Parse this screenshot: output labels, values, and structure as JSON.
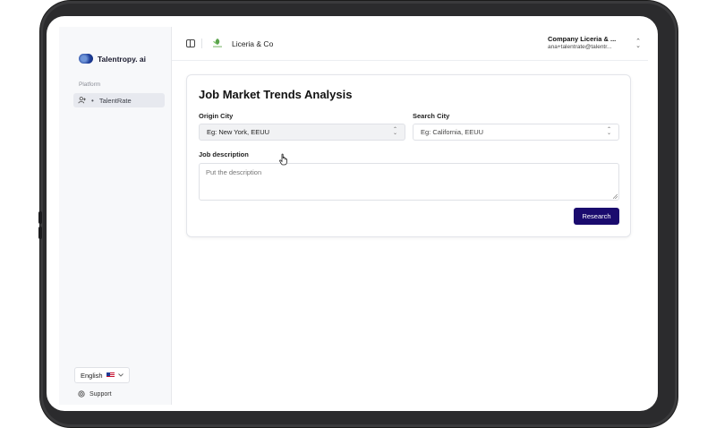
{
  "sidebar": {
    "brand": "Talentropy. ai",
    "group_label": "Platform",
    "items": [
      {
        "label": "TalentRate",
        "icon": "user-plus-icon"
      }
    ],
    "language": "English",
    "support": "Support"
  },
  "topbar": {
    "organization": "Liceria & Co",
    "company": "Company Liceria & ...",
    "email": "ana+talentrate@talentr..."
  },
  "form": {
    "title": "Job Market Trends Analysis",
    "origin_label": "Origin City",
    "origin_placeholder": "Eg: New York, EEUU",
    "search_label": "Search City",
    "search_placeholder": "Eg: California, EEUU",
    "description_label": "Job description",
    "description_placeholder": "Put the description",
    "submit_label": "Research"
  },
  "colors": {
    "primary": "#1a0b6e",
    "sidebar_bg": "#f7f8fa",
    "brand_blue": "#1f3f9a"
  }
}
